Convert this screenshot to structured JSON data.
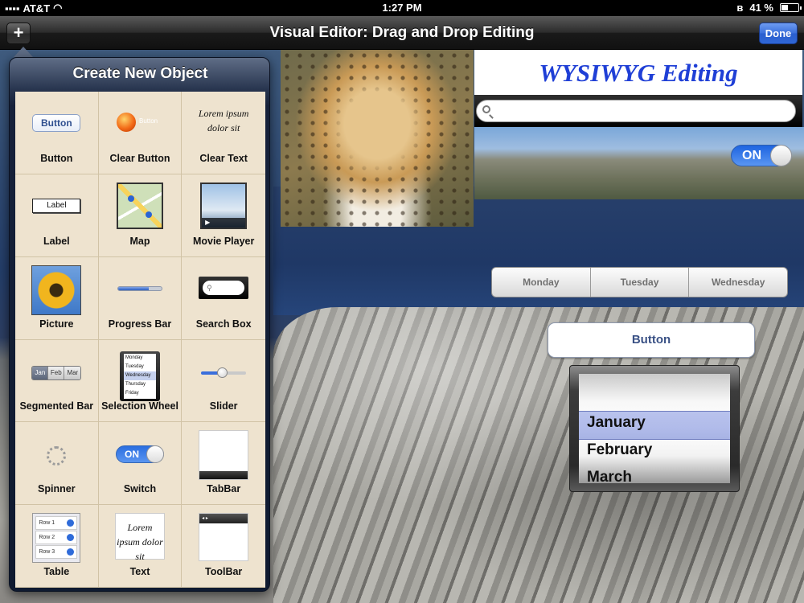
{
  "status_bar": {
    "carrier": "AT&T",
    "time": "1:27 PM",
    "battery": "41 %",
    "battery_level": 0.41
  },
  "nav": {
    "title": "Visual Editor: Drag and Drop Editing",
    "add_label": "+",
    "done_label": "Done"
  },
  "popover": {
    "title": "Create New Object",
    "items": [
      {
        "label": "Button",
        "preview_text": "Button"
      },
      {
        "label": "Clear Button",
        "preview_text": "Button"
      },
      {
        "label": "Clear Text",
        "preview_text": "Lorem ipsum dolor sit"
      },
      {
        "label": "Label",
        "preview_text": "Label"
      },
      {
        "label": "Map"
      },
      {
        "label": "Movie Player"
      },
      {
        "label": "Picture"
      },
      {
        "label": "Progress Bar",
        "progress": 0.7
      },
      {
        "label": "Search Box"
      },
      {
        "label": "Segmented Bar",
        "segments": [
          "Jan",
          "Feb",
          "Mar"
        ]
      },
      {
        "label": "Selection Wheel",
        "rows": [
          "Monday",
          "Tuesday",
          "Wednesday",
          "Thursday",
          "Friday"
        ]
      },
      {
        "label": "Slider",
        "value": 0.45
      },
      {
        "label": "Spinner"
      },
      {
        "label": "Switch",
        "preview_text": "ON"
      },
      {
        "label": "TabBar"
      },
      {
        "label": "Table",
        "rows": [
          "Row 1",
          "Row 2",
          "Row 3"
        ]
      },
      {
        "label": "Text",
        "preview_text": "Lorem ipsum dolor sit"
      },
      {
        "label": "ToolBar"
      }
    ]
  },
  "canvas": {
    "title_text": "WYSIWYG Editing",
    "search_placeholder": "",
    "switch_label": "ON",
    "segments": [
      "Monday",
      "Tuesday",
      "Wednesday"
    ],
    "button_label": "Button",
    "wheel_items": [
      "January",
      "February",
      "March"
    ]
  },
  "colors": {
    "accent": "#2a64d4",
    "title_blue": "#1f3fd6",
    "popover_bg": "#eee3cf"
  }
}
